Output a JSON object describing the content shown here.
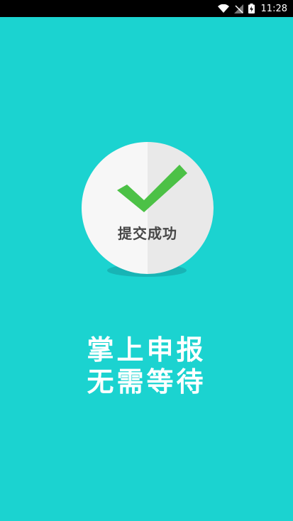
{
  "status_bar": {
    "time": "11:28",
    "icons": [
      "wifi-icon",
      "signal-off-icon",
      "battery-charging-icon"
    ]
  },
  "result": {
    "icon": "checkmark-icon",
    "label": "提交成功"
  },
  "slogan": {
    "line1": "掌上申报",
    "line2": "无需等待"
  },
  "colors": {
    "background": "#1bd3d0",
    "check": "#4cc146",
    "circle": "#f7f7f7",
    "label": "#474747"
  }
}
